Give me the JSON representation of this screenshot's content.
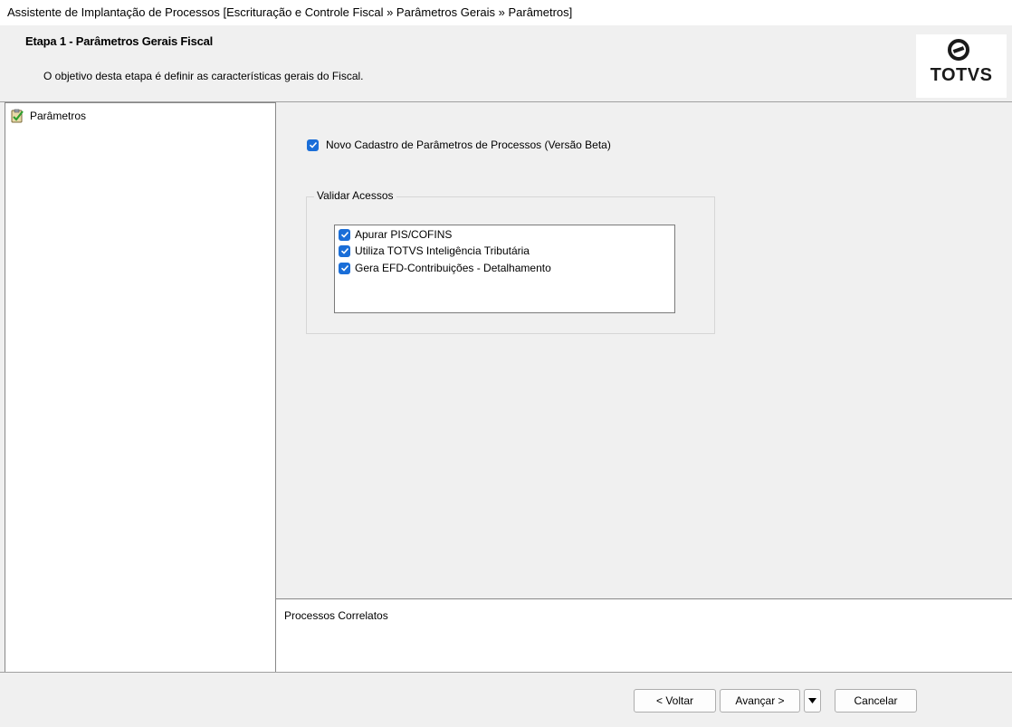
{
  "window": {
    "title": "Assistente de Implantação de Processos [Escrituração e Controle Fiscal » Parâmetros Gerais » Parâmetros]"
  },
  "header": {
    "step_title": "Etapa 1 - Parâmetros Gerais Fiscal",
    "step_description": "O objetivo desta etapa é definir as características gerais do Fiscal.",
    "logo_text": "TOTVS"
  },
  "tree": {
    "items": [
      {
        "label": "Parâmetros",
        "icon": "checklist-icon"
      }
    ]
  },
  "options": {
    "novo_cadastro": {
      "label": "Novo Cadastro de Parâmetros de Processos (Versão Beta)",
      "checked": true
    }
  },
  "validar_acessos": {
    "legend": "Validar Acessos",
    "items": [
      {
        "label": "Apurar PIS/COFINS",
        "checked": true
      },
      {
        "label": "Utiliza TOTVS Inteligência Tributária",
        "checked": true
      },
      {
        "label": "Gera EFD-Contribuições - Detalhamento",
        "checked": true
      }
    ]
  },
  "correlatos": {
    "label": "Processos Correlatos"
  },
  "footer": {
    "voltar": "< Voltar",
    "avancar": "Avançar >",
    "cancelar": "Cancelar"
  },
  "colors": {
    "checkbox": "#1a6ed8",
    "background": "#f0f0f0"
  }
}
